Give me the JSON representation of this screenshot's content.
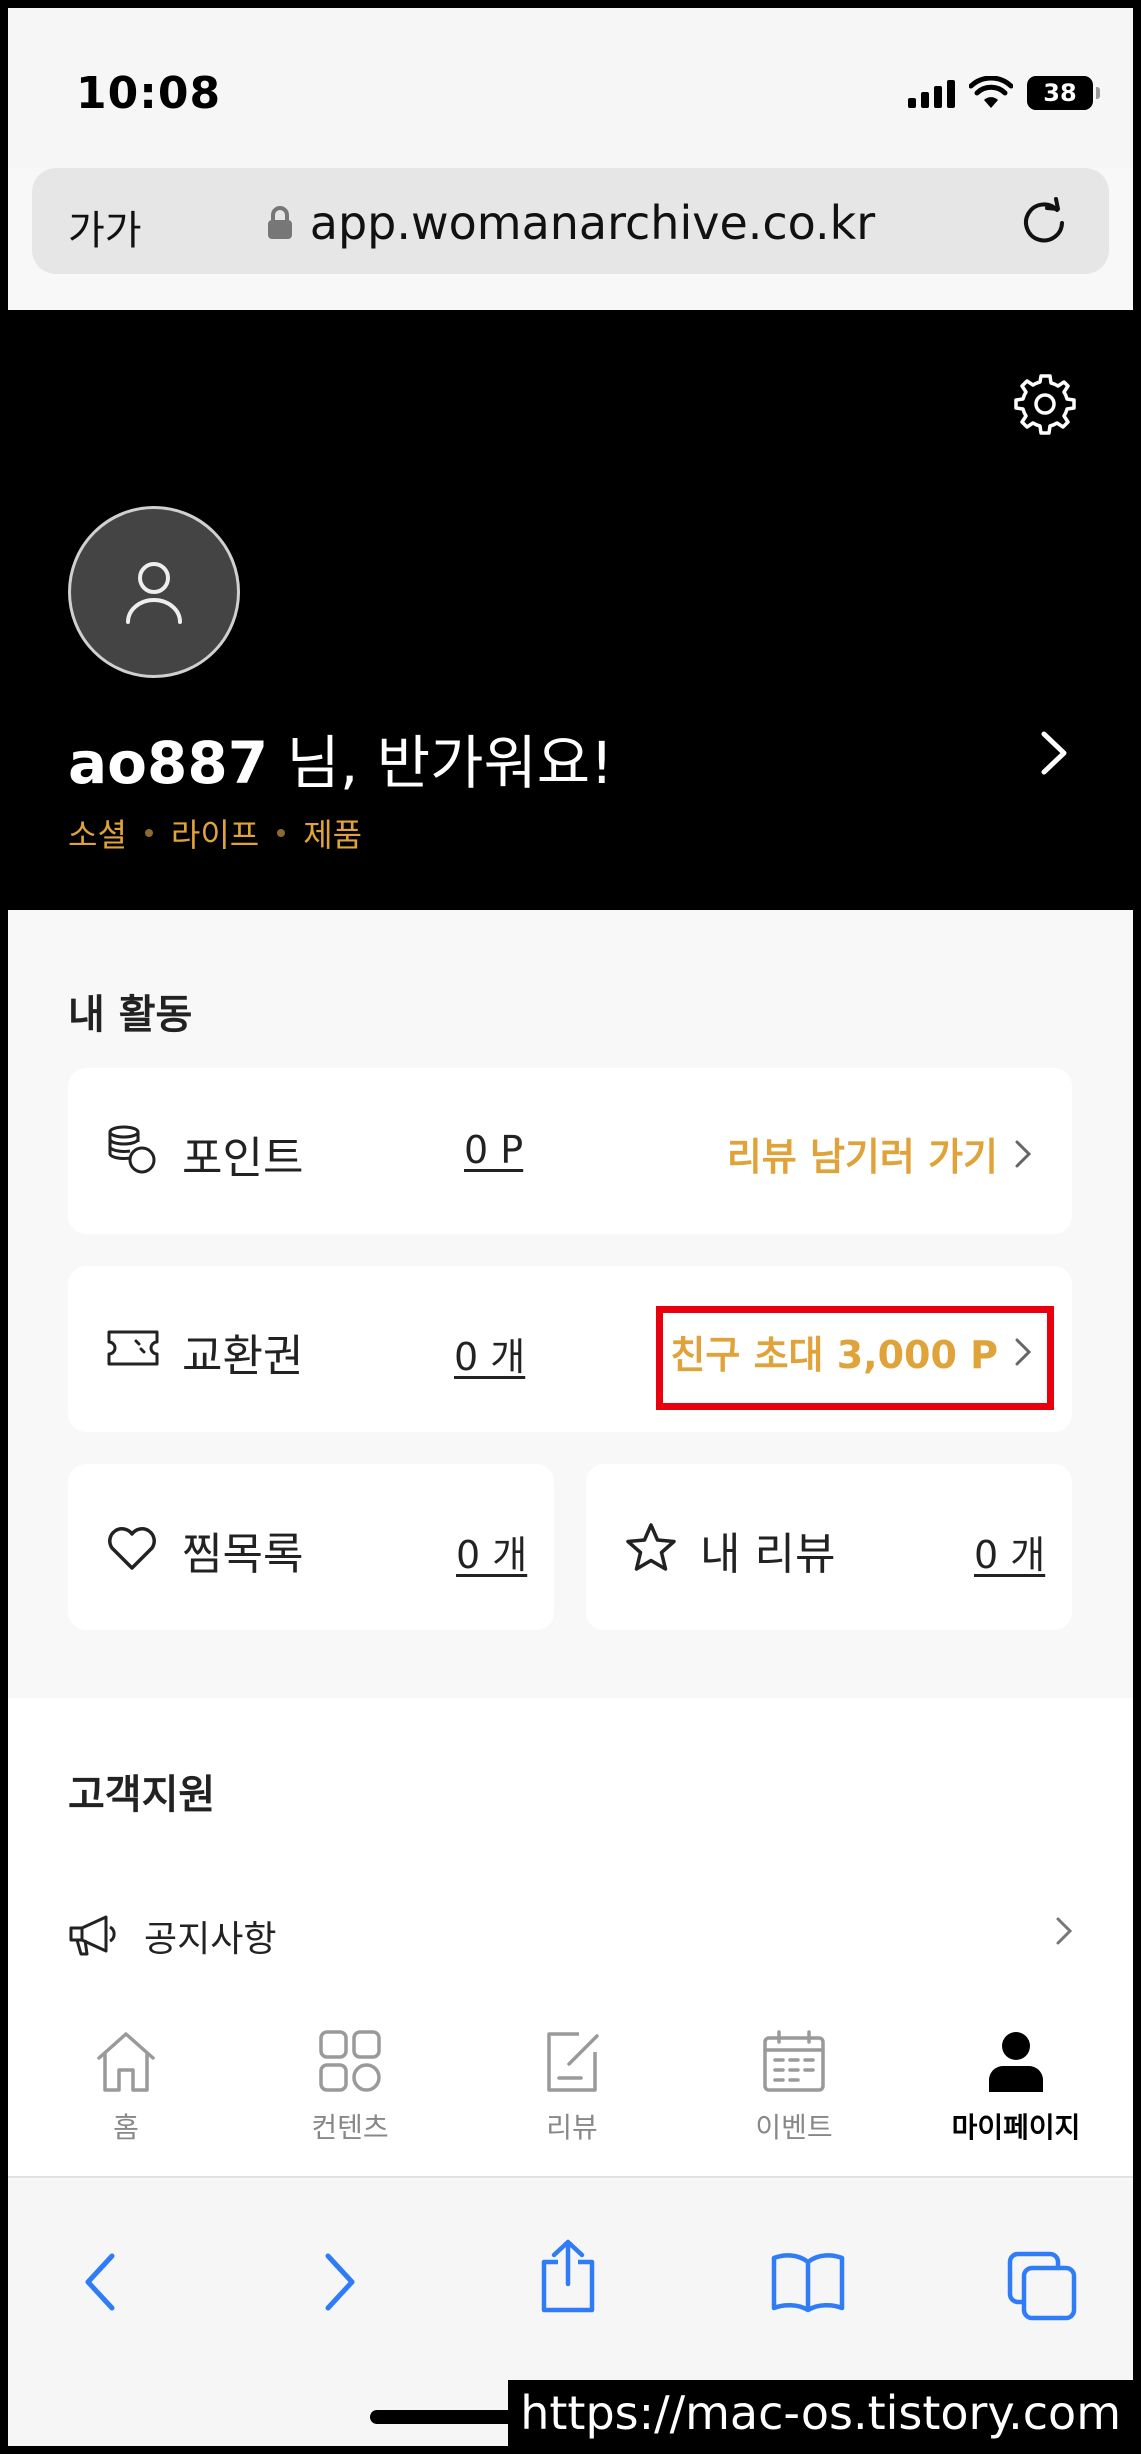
{
  "status": {
    "time": "10:08",
    "battery": "38"
  },
  "browser": {
    "text_size": "가가",
    "url": "app.womanarchive.co.kr"
  },
  "profile": {
    "username": "ao887",
    "greeting_suffix": " 님, 반가워요!",
    "tags": [
      "소셜",
      "라이프",
      "제품"
    ]
  },
  "activity": {
    "title": "내 활동",
    "points": {
      "label": "포인트",
      "value": "0 P",
      "link": "리뷰 남기러 가기"
    },
    "vouchers": {
      "label": "교환권",
      "value": "0 개",
      "link": "친구 초대 3,000 P"
    },
    "wishlist": {
      "label": "찜목록",
      "value": "0 개"
    },
    "my_reviews": {
      "label": "내 리뷰",
      "value": "0 개"
    }
  },
  "support": {
    "title": "고객지원",
    "notice": "공지사항"
  },
  "tabs": [
    {
      "label": "홈",
      "icon": "home-icon"
    },
    {
      "label": "컨텐츠",
      "icon": "grid-icon"
    },
    {
      "label": "리뷰",
      "icon": "review-edit-icon"
    },
    {
      "label": "이벤트",
      "icon": "calendar-icon"
    },
    {
      "label": "마이페이지",
      "icon": "person-icon",
      "active": true
    }
  ],
  "watermark": "https://mac-os.tistory.com",
  "colors": {
    "accent": "#e0a33a",
    "highlight": "#e8000c",
    "header_bg": "#000000"
  }
}
